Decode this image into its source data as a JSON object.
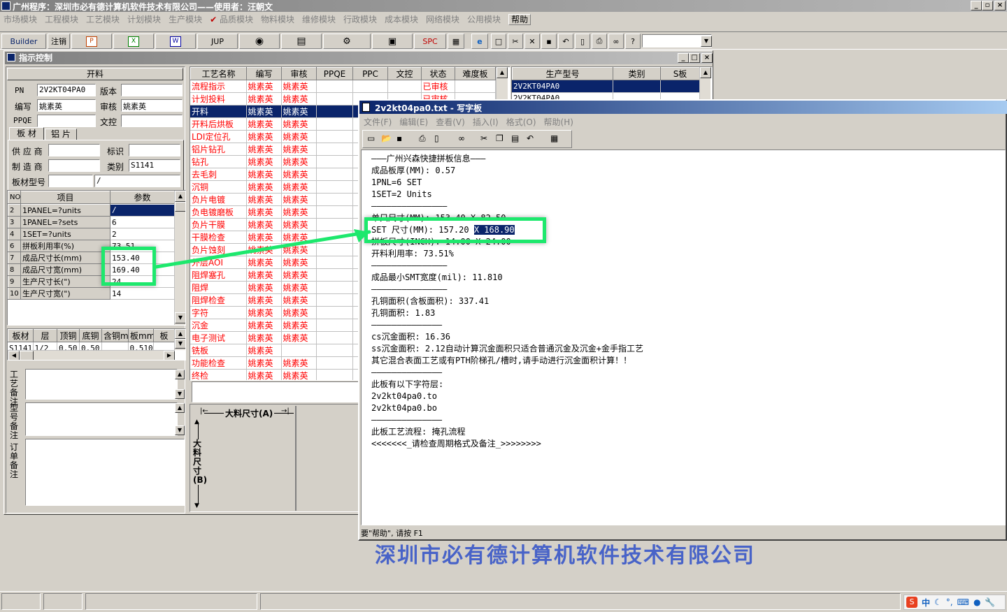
{
  "app": {
    "title": "广州程序：深圳市必有德计算机软件技术有限公司——使用者：汪朝文"
  },
  "menu": [
    "市场模块",
    "工程模块",
    "工艺模块",
    "计划模块",
    "生产模块",
    "品质模块",
    "物料模块",
    "维修模块",
    "行政模块",
    "成本模块",
    "网络模块",
    "公用模块",
    "帮助"
  ],
  "toolbar": {
    "builder": "Builder",
    "logout": "注销",
    "jup": "JUP",
    "spc": "SPC"
  },
  "child": {
    "title": "指示控制",
    "group_title": "开料",
    "pn_label": "PN",
    "pn": "2V2KT04PA0",
    "version_label": "版本",
    "version": "",
    "author_label": "编写",
    "author": "姚素英",
    "review_label": "审核",
    "review": "姚素英",
    "ppqe_label": "PPQE",
    "ppqe": "",
    "wenkong_label": "文控",
    "wenkong": "",
    "tabs": [
      "板 材",
      "铝 片"
    ],
    "supplier_label": "供 应 商",
    "supplier": "",
    "mark_label": "标识",
    "mark": "",
    "maker_label": "制 造 商",
    "maker": "",
    "category_label": "类别",
    "category": "S1141",
    "model_label": "板材型号",
    "model_a": "",
    "model_b": "/",
    "param_headers": [
      "NO",
      "项目",
      "参数"
    ],
    "params": [
      {
        "no": "2",
        "item": "1PANEL=?units",
        "val": "/"
      },
      {
        "no": "3",
        "item": "1PANEL=?sets",
        "val": "6"
      },
      {
        "no": "4",
        "item": "1SET=?units",
        "val": "2"
      },
      {
        "no": "6",
        "item": "拼板利用率(%)",
        "val": "73.51"
      },
      {
        "no": "7",
        "item": "成品尺寸长(mm)",
        "val": "153.40"
      },
      {
        "no": "8",
        "item": "成品尺寸宽(mm)",
        "val": "169.40"
      },
      {
        "no": "9",
        "item": "生产尺寸长(\")",
        "val": "24"
      },
      {
        "no": "10",
        "item": "生产尺寸宽(\")",
        "val": "14"
      }
    ],
    "board_headers": [
      "板材",
      "层",
      "顶铜",
      "底铜",
      "含铜mm",
      "板mm",
      "板"
    ],
    "board_row": [
      "S1141",
      "1/2",
      "0.50",
      "0.50",
      "",
      "0.510",
      ""
    ],
    "note_labels": [
      "工艺备注",
      "型号备注",
      "订单备注"
    ],
    "process_headers": [
      "工艺名称",
      "编写",
      "审核",
      "PPQE",
      "PPC",
      "文控",
      "状态",
      "难度板"
    ],
    "process": [
      {
        "name": "流程指示",
        "w": "姚素英",
        "r": "姚素英",
        "status": "已审核"
      },
      {
        "name": "计划投料",
        "w": "姚素英",
        "r": "姚素英",
        "status": "已审核"
      },
      {
        "name": "开料",
        "w": "姚素英",
        "r": "姚素英",
        "status": ""
      },
      {
        "name": "开料后烘板",
        "w": "姚素英",
        "r": "姚素英",
        "status": ""
      },
      {
        "name": "LDI定位孔",
        "w": "姚素英",
        "r": "姚素英",
        "status": ""
      },
      {
        "name": "铝片钻孔",
        "w": "姚素英",
        "r": "姚素英",
        "status": ""
      },
      {
        "name": "钻孔",
        "w": "姚素英",
        "r": "姚素英",
        "status": ""
      },
      {
        "name": "去毛刺",
        "w": "姚素英",
        "r": "姚素英",
        "status": ""
      },
      {
        "name": "沉铜",
        "w": "姚素英",
        "r": "姚素英",
        "status": ""
      },
      {
        "name": "负片电镀",
        "w": "姚素英",
        "r": "姚素英",
        "status": ""
      },
      {
        "name": "负电镀磨板",
        "w": "姚素英",
        "r": "姚素英",
        "status": ""
      },
      {
        "name": "负片干膜",
        "w": "姚素英",
        "r": "姚素英",
        "status": ""
      },
      {
        "name": "干膜检查",
        "w": "姚素英",
        "r": "姚素英",
        "status": ""
      },
      {
        "name": "负片蚀刻",
        "w": "姚素英",
        "r": "姚素英",
        "status": ""
      },
      {
        "name": "外层AOI",
        "w": "姚素英",
        "r": "姚素英",
        "status": ""
      },
      {
        "name": "阻焊塞孔",
        "w": "姚素英",
        "r": "姚素英",
        "status": ""
      },
      {
        "name": "阻焊",
        "w": "姚素英",
        "r": "姚素英",
        "status": ""
      },
      {
        "name": "阻焊检查",
        "w": "姚素英",
        "r": "姚素英",
        "status": ""
      },
      {
        "name": "字符",
        "w": "姚素英",
        "r": "姚素英",
        "status": ""
      },
      {
        "name": "沉金",
        "w": "姚素英",
        "r": "姚素英",
        "status": ""
      },
      {
        "name": "电子测试",
        "w": "姚素英",
        "r": "姚素英",
        "status": ""
      },
      {
        "name": "铣板",
        "w": "姚素英",
        "r": "",
        "status": ""
      },
      {
        "name": "功能检查",
        "w": "姚素英",
        "r": "姚素英",
        "status": ""
      },
      {
        "name": "终检",
        "w": "姚素英",
        "r": "姚素英",
        "status": ""
      }
    ],
    "model_headers": [
      "生产型号",
      "类别",
      "S板"
    ],
    "models": [
      {
        "model": "2V2KT04PA0",
        "cat": "",
        "s": ""
      },
      {
        "model": "2V2KT04PA0",
        "cat": "",
        "s": ""
      }
    ],
    "diagram": {
      "a_label": "大料尺寸(A)",
      "b_label": "大料尺寸(B)"
    }
  },
  "wordpad": {
    "title": "2v2kt04pa0.txt - 写字板",
    "menu": [
      "文件(F)",
      "编辑(E)",
      "查看(V)",
      "插入(I)",
      "格式(O)",
      "帮助(H)"
    ],
    "lines": [
      "———广州兴森快捷拼板信息———",
      "成品板厚(MM): 0.57",
      "1PNL=6 SET",
      "1SET=2 Units",
      "———————————————",
      "单只尺寸(MM): 153.40 X 82.50",
      "SET 尺寸(MM): 157.20 X 168.90",
      "拼板尺寸(INCH): 14.00 X 24.00",
      "开料利用率: 73.51%",
      "———————————————",
      "成品最小SMT宽度(mil): 11.810",
      "———————————————",
      "孔铜面积(含板面积): 337.41",
      "孔铜面积: 1.83",
      "——————————————",
      "cs沉金面积: 16.36",
      "ss沉金面积: 2.12自动计算沉金面积只适合普通沉金及沉金+金手指工艺",
      "其它混合表面工艺或有PTH阶梯孔/槽时,请手动进行沉金面积计算！！",
      "——————————————",
      "此板有以下字符层:",
      "2v2kt04pa0.to",
      "2v2kt04pa0.bo",
      "——————————————",
      "此板工艺流程: 掩孔流程",
      "<<<<<<<_请检查周期格式及备注_>>>>>>>>"
    ],
    "status": "要\"帮助\", 请按 F1"
  },
  "background_company": "深圳市必有德计算机软件技术有限公司",
  "tray": {
    "ime": "中"
  },
  "colors": {
    "accent": "#1de86d",
    "selection": "#0a246a",
    "red_text": "#ff0000"
  }
}
